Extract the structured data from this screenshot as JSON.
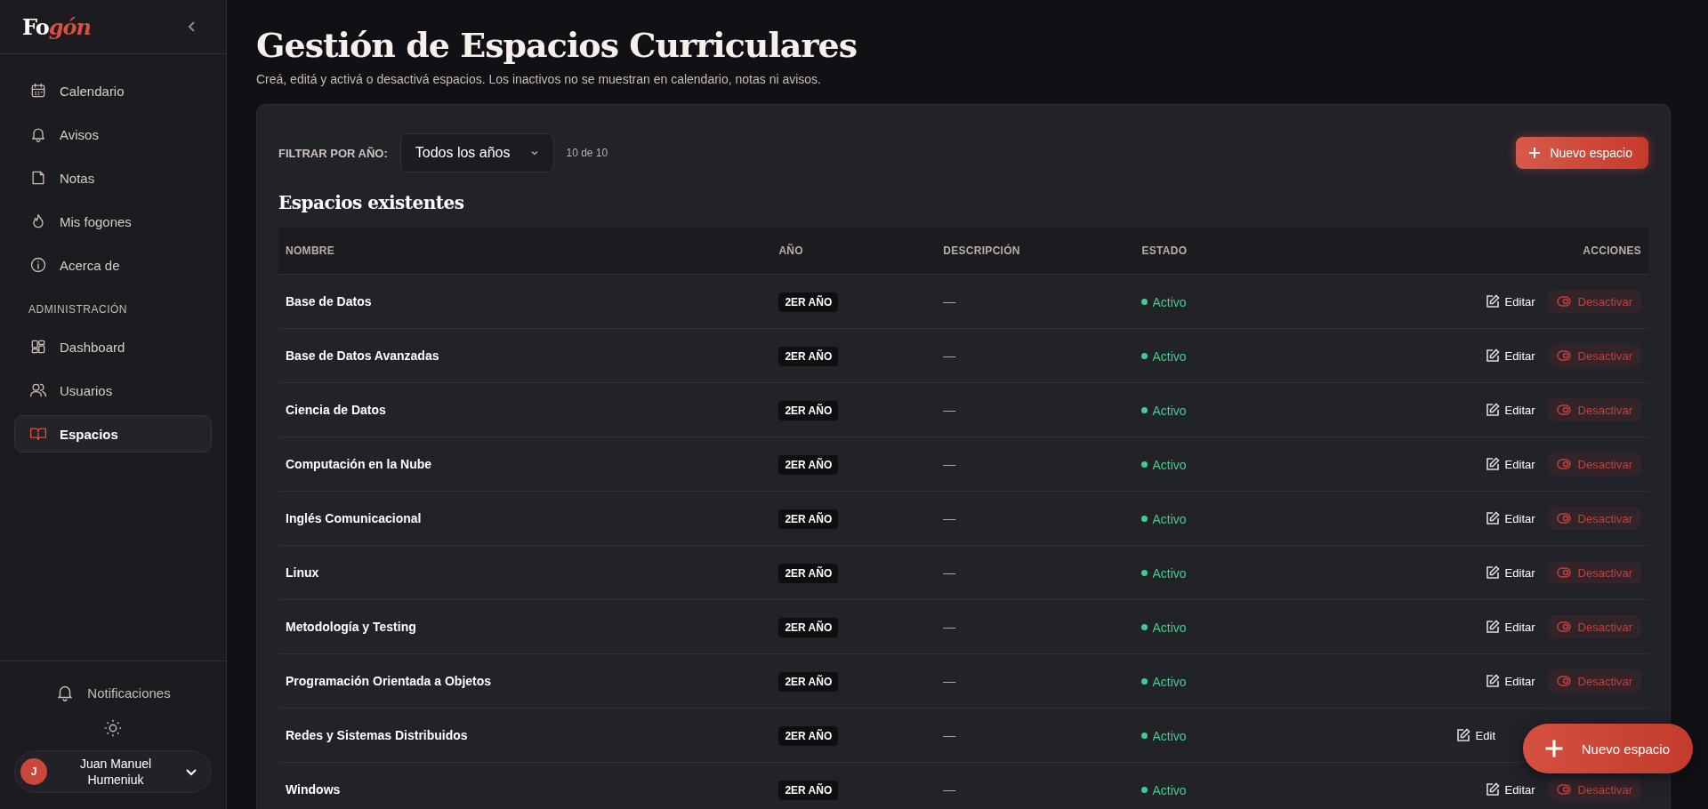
{
  "sidebar": {
    "logo": {
      "first": "Fo",
      "accent": "gón"
    },
    "nav": [
      {
        "label": "Calendario",
        "selected": false
      },
      {
        "label": "Avisos",
        "selected": false
      },
      {
        "label": "Notas",
        "selected": false
      },
      {
        "label": "Mis fogones",
        "selected": false
      },
      {
        "label": "Acerca de",
        "selected": false
      }
    ],
    "section": "ADMINISTRACIÓN",
    "admin": [
      {
        "label": "Dashboard",
        "selected": false
      },
      {
        "label": "Usuarios",
        "selected": false
      },
      {
        "label": "Espacios",
        "selected": true
      }
    ],
    "notifications": "Notificaciones",
    "user": {
      "initial": "J",
      "name": "Juan Manuel Humeniuk"
    }
  },
  "page": {
    "title": "Gestión de Espacios Curriculares",
    "subtitle": "Creá, editá y activá o desactivá espacios. Los inactivos no se muestran en calendario, notas ni avisos."
  },
  "filter": {
    "label": "FILTRAR POR AÑO:",
    "value": "Todos los años",
    "count": "10 de 10"
  },
  "new_button": "Nuevo espacio",
  "section_title": "Espacios existentes",
  "table": {
    "columns": [
      "NOMBRE",
      "AÑO",
      "DESCRIPCIÓN",
      "ESTADO",
      "ACCIONES"
    ],
    "rows": [
      {
        "name": "Base de Datos",
        "year": "2ER AÑO",
        "description": "—",
        "status": "Activo",
        "active": true,
        "edit": "Editar",
        "toggle": "Desactivar"
      },
      {
        "name": "Base de Datos Avanzadas",
        "year": "2ER AÑO",
        "description": "—",
        "status": "Activo",
        "active": true,
        "edit": "Editar",
        "toggle": "Desactivar"
      },
      {
        "name": "Ciencia de Datos",
        "year": "2ER AÑO",
        "description": "—",
        "status": "Activo",
        "active": true,
        "edit": "Editar",
        "toggle": "Desactivar"
      },
      {
        "name": "Computación en la Nube",
        "year": "2ER AÑO",
        "description": "—",
        "status": "Activo",
        "active": true,
        "edit": "Editar",
        "toggle": "Desactivar"
      },
      {
        "name": "Inglés Comunicacional",
        "year": "2ER AÑO",
        "description": "—",
        "status": "Activo",
        "active": true,
        "edit": "Editar",
        "toggle": "Desactivar"
      },
      {
        "name": "Linux",
        "year": "2ER AÑO",
        "description": "—",
        "status": "Activo",
        "active": true,
        "edit": "Editar",
        "toggle": "Desactivar"
      },
      {
        "name": "Metodología y Testing",
        "year": "2ER AÑO",
        "description": "—",
        "status": "Activo",
        "active": true,
        "edit": "Editar",
        "toggle": "Desactivar"
      },
      {
        "name": "Programación Orientada a Objetos",
        "year": "2ER AÑO",
        "description": "—",
        "status": "Activo",
        "active": true,
        "edit": "Editar",
        "toggle": "Desactivar"
      },
      {
        "name": "Redes y Sistemas Distribuidos",
        "year": "2ER AÑO",
        "description": "—",
        "status": "Activo",
        "active": true,
        "edit": "Edit"
      },
      {
        "name": "Windows",
        "year": "2ER AÑO",
        "description": "—",
        "status": "Activo",
        "active": true,
        "edit": "Editar",
        "toggle": "Desactivar"
      }
    ]
  },
  "fab": "Nuevo espacio"
}
